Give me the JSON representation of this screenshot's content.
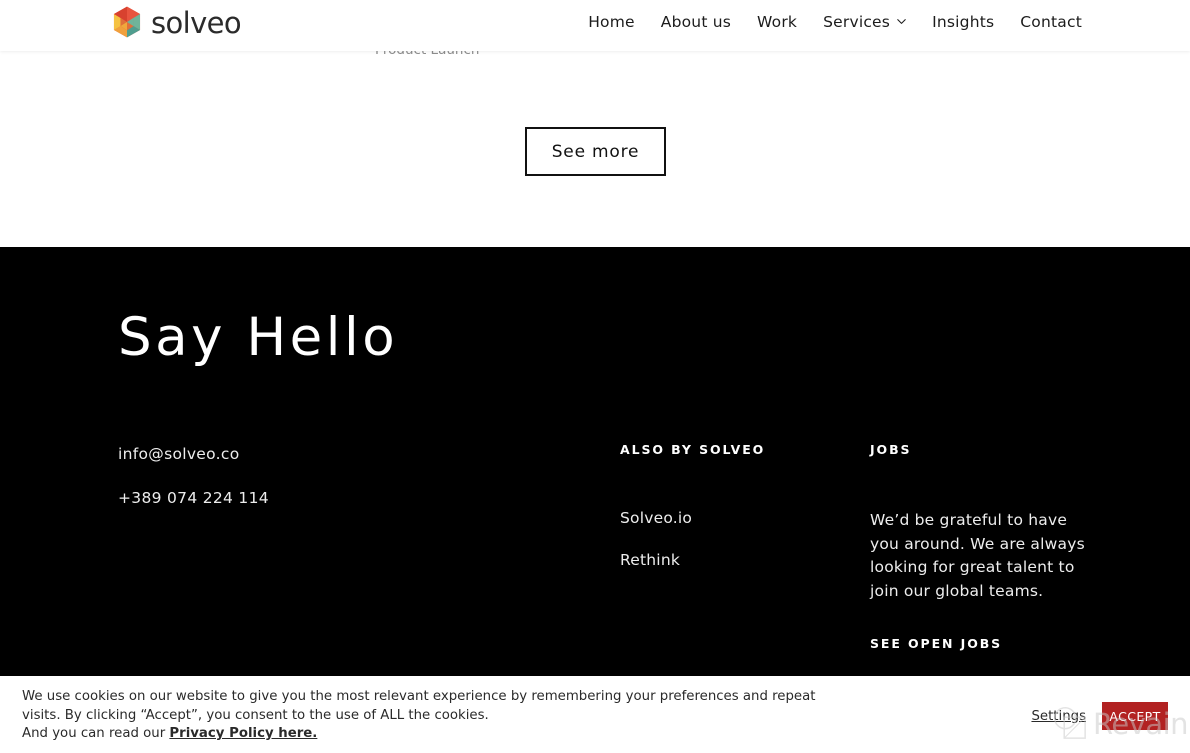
{
  "header": {
    "brand_name": "solveo",
    "logo_icon": "solveo-hexagon-logo",
    "nav": [
      {
        "label": "Home",
        "has_dropdown": false
      },
      {
        "label": "About us",
        "has_dropdown": false
      },
      {
        "label": "Work",
        "has_dropdown": false
      },
      {
        "label": "Services",
        "has_dropdown": true,
        "dropdown_icon": "chevron-down-icon"
      },
      {
        "label": "Insights",
        "has_dropdown": false
      },
      {
        "label": "Contact",
        "has_dropdown": false
      }
    ]
  },
  "main": {
    "cutoff_label": "Product Launch",
    "see_more_label": "See more"
  },
  "footer": {
    "heading": "Say Hello",
    "email": "info@solveo.co",
    "phone": "+389 074 224 114",
    "also_by": {
      "title": "ALSO BY SOLVEO",
      "links": [
        {
          "label": "Solveo.io"
        },
        {
          "label": "Rethink"
        }
      ]
    },
    "jobs": {
      "title": "JOBS",
      "body": "We’d be grateful to have you around. We are always looking for great talent to join our global teams.",
      "cta": "SEE OPEN JOBS"
    }
  },
  "cookie_banner": {
    "body_part1": "We use cookies on our website to give you the most relevant experience by remembering your preferences and repeat visits. By clicking “Accept”, you consent to the use of ALL the cookies.",
    "body_part2_prefix": "And you can read our ",
    "privacy_link": "Privacy Policy here.",
    "settings_label": "Settings",
    "accept_label": "ACCEPT"
  },
  "watermark": {
    "text": "Revain",
    "icon": "magnifier-square-icon"
  },
  "colors": {
    "accept_red": "#b22222",
    "footer_background": "#000000",
    "page_background": "#ffffff",
    "watermark_gray": "#c9c9c9"
  }
}
